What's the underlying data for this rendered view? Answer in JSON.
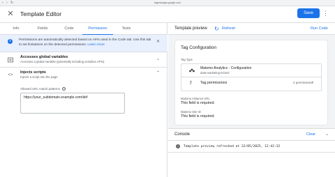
{
  "browser": {
    "url": "tagmanager.google.com"
  },
  "header": {
    "title": "Template Editor",
    "save_label": "Save"
  },
  "tabs": [
    {
      "label": "Info"
    },
    {
      "label": "Fields"
    },
    {
      "label": "Code"
    },
    {
      "label": "Permission"
    },
    {
      "label": "Tests"
    }
  ],
  "info_banner": {
    "text": "Permissions are automatically detected based on APIs used in the Code tab. Use this tab to set limitations on the detected permissions.",
    "link": "Learn more"
  },
  "permissions": {
    "global": {
      "title": "Accesses global variables",
      "subtitle": "Accesses a global variable (potentially including sensitive APIs)"
    },
    "scripts": {
      "title": "Injects scripts",
      "subtitle": "Injects a script into the page",
      "field_label": "Allowed URL match patterns",
      "field_value": "https://your_subdomain.example.com/def"
    }
  },
  "preview": {
    "title": "Template preview",
    "refresh": "Refresh",
    "run_code": "Run Code",
    "card": {
      "title": "Tag Configuration",
      "tag_type_label": "Tag Type",
      "tag_type_name": "Matomo Analytics - Configuration",
      "tag_type_sub": "data-marketing-school",
      "tag_permissions_label": "Tag permissions",
      "tag_permissions_count": "2 permissions",
      "instance_url_label": "Matomo Instance URL",
      "instance_url_value": "This field is required.",
      "site_id_label": "Matomo Site ID",
      "site_id_value": "This field is required."
    }
  },
  "console": {
    "title": "Console",
    "clear": "Clear",
    "log": "Template preview refreshed at 22/05/2025, 12:42:32"
  },
  "colors": {
    "accent": "#1a73e8",
    "banner_bg": "#e8f0fe",
    "panel_bg": "#f1f3f4"
  },
  "icons": [
    "close-icon",
    "more-vert-icon",
    "info-icon",
    "globe-icon",
    "code-icon",
    "chevron-icon",
    "refresh-icon",
    "help-icon",
    "matomo-icon",
    "key-icon",
    "log-info-icon"
  ]
}
